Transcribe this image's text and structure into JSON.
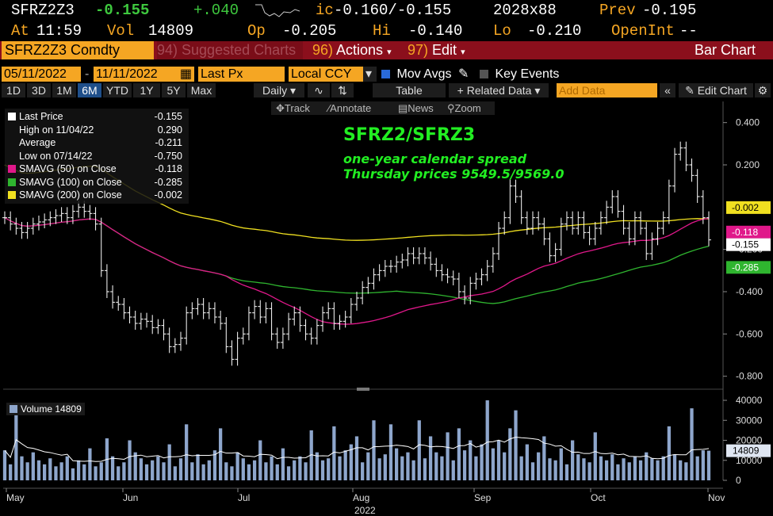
{
  "header": {
    "ticker": "SFRZ2Z3",
    "last_change": "-0.155",
    "net_change": "+.040",
    "ic_label": "ic",
    "bid_ask": "-0.160/-0.155",
    "size": "2028x88",
    "prev_label": "Prev",
    "prev_value": "-0.195",
    "at_label": "At",
    "time": "11:59",
    "vol_label": "Vol",
    "vol_value": "14809",
    "op_label": "Op",
    "op_value": "-0.205",
    "hi_label": "Hi",
    "hi_value": "-0.140",
    "lo_label": "Lo",
    "lo_value": "-0.210",
    "oi_label": "OpenInt",
    "oi_value": "--"
  },
  "menubar": {
    "security": "SFRZ2Z3 Comdty",
    "suggested_num": "94)",
    "suggested": "Suggested Charts",
    "actions_num": "96)",
    "actions": "Actions",
    "edit_num": "97)",
    "edit": "Edit",
    "chart_type": "Bar Chart"
  },
  "controls": {
    "start_date": "05/11/2022",
    "end_date": "11/11/2022",
    "field": "Last Px",
    "currency": "Local CCY",
    "mov_avgs": "Mov Avgs",
    "key_events": "Key Events"
  },
  "ranges": [
    "1D",
    "3D",
    "1M",
    "6M",
    "YTD",
    "1Y",
    "5Y",
    "Max"
  ],
  "range_selected": "6M",
  "toolbar": {
    "period": "Daily",
    "table": "Table",
    "related": "+ Related Data",
    "add_data_placeholder": "Add Data",
    "edit_chart": "Edit Chart"
  },
  "tools": {
    "track": "Track",
    "annotate": "Annotate",
    "news": "News",
    "zoom": "Zoom"
  },
  "legend": [
    {
      "label": "Last Price",
      "value": "-0.155",
      "color": "#ffffff"
    },
    {
      "label": "High on 11/04/22",
      "value": "0.290",
      "color": ""
    },
    {
      "label": "Average",
      "value": "-0.211",
      "color": ""
    },
    {
      "label": "Low on 07/14/22",
      "value": "-0.750",
      "color": ""
    },
    {
      "label": "SMAVG (50)  on Close",
      "value": "-0.118",
      "color": "#e0188a"
    },
    {
      "label": "SMAVG (100)  on Close",
      "value": "-0.285",
      "color": "#2fb52f"
    },
    {
      "label": "SMAVG (200)  on Close",
      "value": "-0.002",
      "color": "#f0e020"
    }
  ],
  "annotation": {
    "title": "SFRZ2/SFRZ3",
    "line1": "one-year calendar spread",
    "line2": "Thursday prices 9549.5/9569.0"
  },
  "volume_legend": {
    "label": "Volume",
    "value": "14809"
  },
  "chart_data": {
    "type": "bar",
    "x_labels": [
      "May",
      "Jun",
      "Jul",
      "Aug",
      "Sep",
      "Oct",
      "Nov"
    ],
    "x_year": "2022",
    "ylim": [
      -0.85,
      0.5
    ],
    "yticks": [
      "0.400",
      "0.200",
      "-0.200",
      "-0.400",
      "-0.600",
      "-0.800"
    ],
    "ytick_values": [
      0.4,
      0.2,
      -0.2,
      -0.4,
      -0.6,
      -0.8
    ],
    "price_close": [
      -0.05,
      -0.08,
      -0.1,
      -0.12,
      -0.1,
      -0.08,
      -0.07,
      -0.06,
      -0.05,
      -0.04,
      -0.03,
      -0.05,
      -0.02,
      0.0,
      -0.02,
      -0.03,
      -0.08,
      -0.3,
      -0.4,
      -0.45,
      -0.46,
      -0.5,
      -0.52,
      -0.55,
      -0.53,
      -0.54,
      -0.57,
      -0.56,
      -0.6,
      -0.66,
      -0.65,
      -0.62,
      -0.5,
      -0.48,
      -0.46,
      -0.5,
      -0.48,
      -0.52,
      -0.55,
      -0.66,
      -0.72,
      -0.62,
      -0.6,
      -0.5,
      -0.47,
      -0.52,
      -0.48,
      -0.6,
      -0.64,
      -0.6,
      -0.53,
      -0.5,
      -0.56,
      -0.6,
      -0.62,
      -0.56,
      -0.5,
      -0.48,
      -0.55,
      -0.54,
      -0.52,
      -0.46,
      -0.43,
      -0.38,
      -0.36,
      -0.32,
      -0.3,
      -0.28,
      -0.28,
      -0.26,
      -0.25,
      -0.22,
      -0.24,
      -0.22,
      -0.24,
      -0.27,
      -0.3,
      -0.32,
      -0.33,
      -0.34,
      -0.4,
      -0.43,
      -0.36,
      -0.34,
      -0.32,
      -0.28,
      -0.22,
      -0.1,
      -0.05,
      0.1,
      0.05,
      -0.05,
      -0.1,
      -0.05,
      -0.08,
      -0.15,
      -0.23,
      -0.2,
      -0.08,
      -0.05,
      -0.1,
      -0.05,
      -0.12,
      -0.15,
      -0.1,
      -0.05,
      0.0,
      0.05,
      -0.02,
      -0.1,
      -0.15,
      -0.05,
      -0.1,
      -0.22,
      -0.15,
      -0.1,
      -0.05,
      0.1,
      0.25,
      0.28,
      0.2,
      0.15,
      0.05,
      -0.05,
      -0.155
    ],
    "volume": [
      15000,
      8000,
      38000,
      12000,
      9000,
      14000,
      10000,
      8000,
      11000,
      7000,
      9000,
      12000,
      6000,
      10000,
      8000,
      16000,
      7000,
      9000,
      21000,
      12000,
      7000,
      9000,
      20000,
      14000,
      11000,
      8000,
      10000,
      12000,
      9000,
      18000,
      7000,
      11000,
      28000,
      9000,
      13000,
      8000,
      10000,
      15000,
      26000,
      9000,
      7000,
      14000,
      11000,
      8000,
      10000,
      20000,
      9000,
      12000,
      8000,
      16000,
      7000,
      10000,
      12000,
      9000,
      25000,
      14000,
      10000,
      11000,
      27000,
      12000,
      15000,
      18000,
      22000,
      9000,
      14000,
      30000,
      11000,
      13000,
      28000,
      16000,
      12000,
      14000,
      10000,
      30000,
      11000,
      22000,
      14000,
      12000,
      24000,
      10000,
      26000,
      15000,
      20000,
      12000,
      18000,
      40000,
      16000,
      20000,
      14000,
      26000,
      35000,
      12000,
      18000,
      9000,
      14000,
      22000,
      11000,
      10000,
      16000,
      8000,
      20000,
      13000,
      11000,
      9000,
      24000,
      12000,
      10000,
      13000,
      8000,
      11000,
      9000,
      12000,
      10000,
      14000,
      11000,
      10000,
      12000,
      27000,
      13000,
      10000,
      9000,
      36000,
      12000,
      15000,
      14809
    ],
    "vol_ylim": [
      0,
      42000
    ],
    "vol_yticks": [
      "40000",
      "30000",
      "20000",
      "10000",
      "0"
    ],
    "vol_ytick_values": [
      40000,
      30000,
      20000,
      10000,
      0
    ],
    "sma_labels": [
      "-0.002",
      "-0.118",
      "-0.155",
      "-0.285"
    ],
    "sma_colors": {
      "sma50": "#e0188a",
      "sma100": "#2fb52f",
      "sma200": "#f0e020"
    },
    "vol_last_label": "14809"
  }
}
